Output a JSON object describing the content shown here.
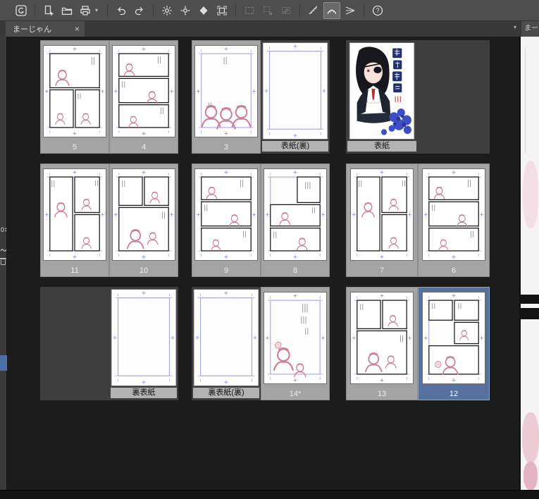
{
  "tabs": {
    "main_tab": "まーじゃん",
    "right_tab": "まー"
  },
  "toolbar": {
    "groups": [
      {
        "icons": [
          {
            "name": "clip-studio-logo"
          }
        ]
      },
      {
        "icons": [
          {
            "name": "new-document"
          },
          {
            "name": "open-file"
          },
          {
            "name": "export",
            "dropdown": true
          }
        ]
      },
      {
        "icons": [
          {
            "name": "undo"
          },
          {
            "name": "redo"
          }
        ]
      },
      {
        "icons": [
          {
            "name": "rotate-view"
          },
          {
            "name": "reset-view"
          },
          {
            "name": "shape-fill"
          },
          {
            "name": "frame-crop"
          }
        ]
      },
      {
        "icons": [
          {
            "name": "select-rect",
            "disabled": true
          },
          {
            "name": "select-move",
            "disabled": true
          },
          {
            "name": "select-fill",
            "disabled": true
          }
        ]
      },
      {
        "icons": [
          {
            "name": "snap-ruler"
          },
          {
            "name": "snap-special-ruler",
            "active": true
          },
          {
            "name": "snap-vanishing"
          }
        ]
      },
      {
        "icons": [
          {
            "name": "help"
          }
        ]
      }
    ]
  },
  "left_rail": {
    "spinner_value": "0"
  },
  "page_manager": {
    "selected_page": "12",
    "rows": [
      {
        "spreads": [
          {
            "slots": [
              {
                "kind": "page",
                "name": "page-5",
                "label": "5",
                "content": "p3a"
              },
              {
                "kind": "page",
                "name": "page-4",
                "label": "4",
                "content": "rows3"
              }
            ]
          },
          {
            "slots": [
              {
                "kind": "page",
                "name": "page-3",
                "label": "3",
                "content": "heads"
              },
              {
                "kind": "cover",
                "name": "front-cover-inside",
                "label": "表紙(裏)",
                "content": "blank"
              }
            ]
          },
          {
            "slots": [
              {
                "kind": "cover",
                "name": "front-cover",
                "label": "表紙",
                "content": "cover"
              },
              {
                "kind": "empty"
              }
            ]
          }
        ]
      },
      {
        "spreads": [
          {
            "slots": [
              {
                "kind": "page",
                "name": "page-11",
                "label": "11",
                "content": "tall2"
              },
              {
                "kind": "page",
                "name": "page-10",
                "label": "10",
                "content": "p3b"
              }
            ]
          },
          {
            "slots": [
              {
                "kind": "page",
                "name": "page-9",
                "label": "9",
                "content": "rows3"
              },
              {
                "kind": "page",
                "name": "page-8",
                "label": "8",
                "content": "grid4"
              }
            ]
          },
          {
            "slots": [
              {
                "kind": "page",
                "name": "page-7",
                "label": "7",
                "content": "tall2"
              },
              {
                "kind": "page",
                "name": "page-6",
                "label": "6",
                "content": "rows3"
              }
            ]
          }
        ]
      },
      {
        "spreads": [
          {
            "slots": [
              {
                "kind": "empty"
              },
              {
                "kind": "cover",
                "name": "back-cover",
                "label": "裏表紙",
                "content": "blank"
              }
            ]
          },
          {
            "slots": [
              {
                "kind": "cover",
                "name": "back-cover-inside",
                "label": "裏表紙(裏)",
                "content": "blank"
              },
              {
                "kind": "page",
                "name": "page-14-modified",
                "label": "14*",
                "content": "sketchtext"
              }
            ]
          },
          {
            "slots": [
              {
                "kind": "page",
                "name": "page-13",
                "label": "13",
                "content": "p3b"
              },
              {
                "kind": "page",
                "name": "page-12",
                "label": "12",
                "content": "p12",
                "selected": true
              }
            ]
          }
        ]
      }
    ]
  },
  "colors": {
    "selection_blue": "#56719e",
    "mat_gray": "#a4a4a4",
    "empty_slot_gray": "#3d3d3d",
    "guide_blue": "#9193d6",
    "sketch_pink": "#cc7f96",
    "workspace_bg": "#1c1c1c",
    "toolbar_bg": "#4e4e4e"
  }
}
